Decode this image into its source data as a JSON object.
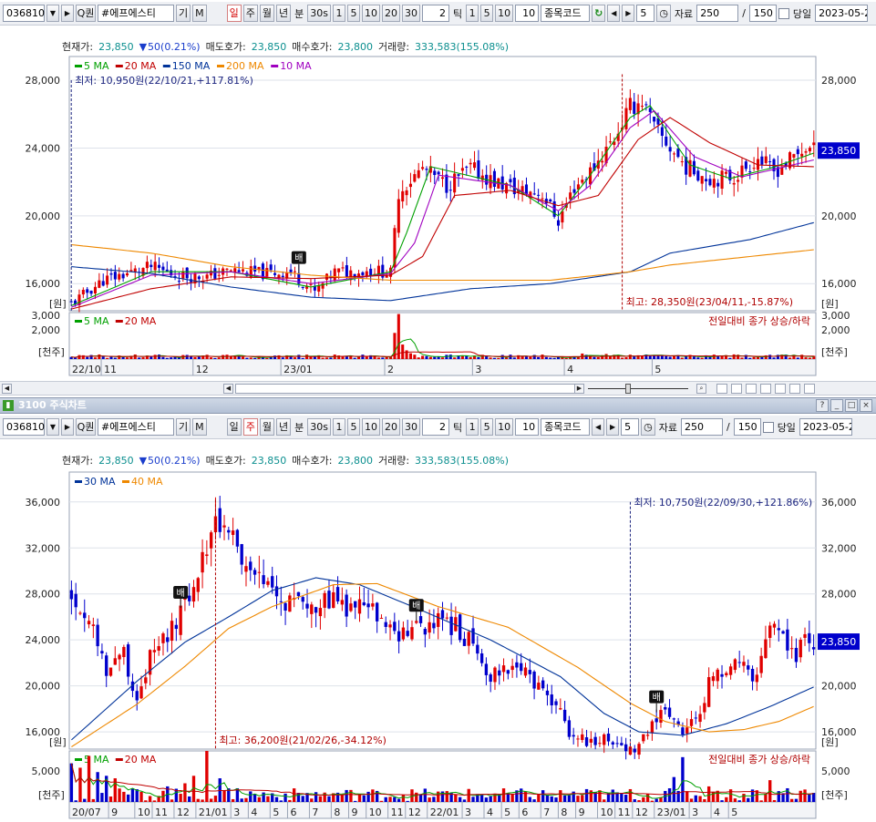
{
  "toolbar": {
    "code": "036810",
    "search_glyph": "Q",
    "search_label": "퀀",
    "name": "#에프에스티",
    "gi": "기",
    "m": "M",
    "periods": [
      "일",
      "주",
      "월",
      "년"
    ],
    "bun": "분",
    "sec30": "30s",
    "intervals": [
      "1",
      "5",
      "10",
      "20",
      "30"
    ],
    "tick_value": "2",
    "tick_label": "틱",
    "tick_intervals": [
      "1",
      "5",
      "10"
    ],
    "tick_num": "10",
    "code_field": "종목코드",
    "refresh_glyph": "↻",
    "step": "5",
    "data_label": "자료",
    "data_count": "250",
    "slash": "/",
    "data_total": "150",
    "today_label": "당일",
    "date": "2023-05-2"
  },
  "info": {
    "price_label": "현재가:",
    "price": "23,850",
    "change_arrow": "▼",
    "change": "50(0.21%)",
    "ask_label": "매도호가:",
    "ask": "23,850",
    "bid_label": "매수호가:",
    "bid": "23,800",
    "volume_label": "거래량:",
    "volume": "333,583(155.08%)"
  },
  "panel_title": "3100 주식차트",
  "panel_window_buttons": [
    "?",
    "_",
    "□",
    "×"
  ],
  "colors": {
    "up": "#e00000",
    "down": "#0000cc",
    "ma5": "#00a000",
    "ma20": "#c00000",
    "ma150": "#003399",
    "ma200": "#ee8800",
    "ma10": "#a000c0",
    "ma30": "#003399",
    "ma40": "#ee8800",
    "price_badge": "#0000ee",
    "grid": "#dde2ea",
    "text": "#222222",
    "annot": "#1a237e",
    "annot_red": "#b00000"
  },
  "chart_data": [
    {
      "type": "candlestick",
      "title": "",
      "period": "daily",
      "ylim": [
        14400,
        29400
      ],
      "yticks": [
        16000,
        20000,
        24000,
        28000
      ],
      "ytick_labels": [
        "16,000",
        "20,000",
        "24,000",
        "28,000"
      ],
      "y_unit": "[원]",
      "current_price": "23,850",
      "legend": [
        {
          "name": "5 MA",
          "color": "#00a000"
        },
        {
          "name": "20 MA",
          "color": "#c00000"
        },
        {
          "name": "150 MA",
          "color": "#003399"
        },
        {
          "name": "200 MA",
          "color": "#ee8800"
        },
        {
          "name": "10 MA",
          "color": "#a000c0"
        }
      ],
      "ohlc_anchors": [
        [
          0,
          14800
        ],
        [
          8,
          16200
        ],
        [
          14,
          16600
        ],
        [
          20,
          17000
        ],
        [
          26,
          16500
        ],
        [
          34,
          16400
        ],
        [
          40,
          16800
        ],
        [
          48,
          16600
        ],
        [
          55,
          16700
        ],
        [
          61,
          15500
        ],
        [
          66,
          16700
        ],
        [
          72,
          16700
        ],
        [
          76,
          16800
        ],
        [
          80,
          16600
        ],
        [
          82,
          21400
        ],
        [
          88,
          22800
        ],
        [
          94,
          21800
        ],
        [
          100,
          22800
        ],
        [
          106,
          22000
        ],
        [
          112,
          21500
        ],
        [
          118,
          21300
        ],
        [
          122,
          19700
        ],
        [
          126,
          21700
        ],
        [
          130,
          22600
        ],
        [
          136,
          24600
        ],
        [
          140,
          26400
        ],
        [
          143,
          26800
        ],
        [
          146,
          25200
        ],
        [
          150,
          24000
        ],
        [
          154,
          22900
        ],
        [
          160,
          22200
        ],
        [
          166,
          22300
        ],
        [
          172,
          23400
        ],
        [
          176,
          22600
        ],
        [
          180,
          23300
        ],
        [
          184,
          24000
        ],
        [
          186,
          23850
        ]
      ],
      "ma_anchors": {
        "5 MA": [
          [
            0,
            14700
          ],
          [
            20,
            16700
          ],
          [
            40,
            16700
          ],
          [
            60,
            15800
          ],
          [
            80,
            16700
          ],
          [
            84,
            19000
          ],
          [
            90,
            22900
          ],
          [
            110,
            21800
          ],
          [
            122,
            20000
          ],
          [
            130,
            22400
          ],
          [
            140,
            25800
          ],
          [
            145,
            26500
          ],
          [
            155,
            23000
          ],
          [
            165,
            22200
          ],
          [
            175,
            22800
          ],
          [
            186,
            23700
          ]
        ],
        "10 MA": [
          [
            0,
            14600
          ],
          [
            20,
            16500
          ],
          [
            40,
            16700
          ],
          [
            60,
            16000
          ],
          [
            80,
            16600
          ],
          [
            86,
            18400
          ],
          [
            92,
            22400
          ],
          [
            110,
            21800
          ],
          [
            122,
            20300
          ],
          [
            130,
            21800
          ],
          [
            140,
            25200
          ],
          [
            146,
            26200
          ],
          [
            156,
            23500
          ],
          [
            168,
            22300
          ],
          [
            186,
            23300
          ]
        ],
        "20 MA": [
          [
            0,
            14500
          ],
          [
            20,
            15700
          ],
          [
            40,
            16400
          ],
          [
            60,
            16300
          ],
          [
            80,
            16500
          ],
          [
            88,
            17600
          ],
          [
            96,
            21200
          ],
          [
            110,
            21500
          ],
          [
            122,
            20600
          ],
          [
            132,
            21200
          ],
          [
            142,
            24500
          ],
          [
            150,
            25800
          ],
          [
            160,
            24300
          ],
          [
            172,
            23000
          ],
          [
            186,
            22900
          ]
        ],
        "150 MA": [
          [
            0,
            17000
          ],
          [
            20,
            16600
          ],
          [
            40,
            15800
          ],
          [
            60,
            15200
          ],
          [
            80,
            15000
          ],
          [
            100,
            15700
          ],
          [
            120,
            16000
          ],
          [
            140,
            16700
          ],
          [
            150,
            17800
          ],
          [
            170,
            18600
          ],
          [
            186,
            19600
          ]
        ],
        "200 MA": [
          [
            0,
            18300
          ],
          [
            20,
            17800
          ],
          [
            40,
            17000
          ],
          [
            60,
            16500
          ],
          [
            80,
            16200
          ],
          [
            100,
            16200
          ],
          [
            120,
            16200
          ],
          [
            140,
            16700
          ],
          [
            150,
            17100
          ],
          [
            170,
            17600
          ],
          [
            186,
            18000
          ]
        ]
      },
      "xticks": [
        {
          "label": "22/10",
          "i": 0
        },
        {
          "label": "11",
          "i": 8
        },
        {
          "label": "12",
          "i": 31
        },
        {
          "label": "23/01",
          "i": 53
        },
        {
          "label": "2",
          "i": 79
        },
        {
          "label": "3",
          "i": 101
        },
        {
          "label": "4",
          "i": 124
        },
        {
          "label": "5",
          "i": 146
        }
      ],
      "annotations": [
        {
          "text": "최저: 10,950원(22/10/21,+117.81%)",
          "i": 0,
          "anchor_y": 28000
        },
        {
          "text": "최고: 28,350원(23/04/11,-15.87%)",
          "i": 138,
          "value": 28350
        }
      ],
      "marker": {
        "text": "배",
        "i": 57
      },
      "volume": {
        "ylim": [
          0,
          3200
        ],
        "yticks": [
          2000,
          3000
        ],
        "ytick_labels": [
          "2,000",
          "3,000"
        ],
        "y_unit": "[천주]",
        "legend": [
          {
            "name": "5 MA",
            "color": "#00a000"
          },
          {
            "name": "20 MA",
            "color": "#c00000"
          }
        ],
        "note": "전일대비 종가 상승/하락",
        "spikes": [
          [
            81,
            1800
          ],
          [
            82,
            3100
          ],
          [
            83,
            1000
          ],
          [
            84,
            600
          ],
          [
            85,
            400
          ],
          [
            110,
            300
          ],
          [
            128,
            380
          ],
          [
            134,
            350
          ],
          [
            140,
            300
          ],
          [
            166,
            320
          ]
        ]
      }
    },
    {
      "type": "candlestick",
      "title": "",
      "period": "weekly",
      "ylim": [
        14500,
        38600
      ],
      "yticks": [
        16000,
        20000,
        24000,
        28000,
        32000,
        36000
      ],
      "ytick_labels": [
        "16,000",
        "20,000",
        "24,000",
        "28,000",
        "32,000",
        "36,000"
      ],
      "y_unit": "[원]",
      "current_price": "23,850",
      "legend": [
        {
          "name": "30 MA",
          "color": "#003399"
        },
        {
          "name": "40 MA",
          "color": "#ee8800"
        }
      ],
      "ohlc_anchors": [
        [
          0,
          27800
        ],
        [
          4,
          25800
        ],
        [
          8,
          21500
        ],
        [
          12,
          22900
        ],
        [
          15,
          18800
        ],
        [
          18,
          22400
        ],
        [
          22,
          24200
        ],
        [
          26,
          26800
        ],
        [
          30,
          30900
        ],
        [
          33,
          34500
        ],
        [
          36,
          34000
        ],
        [
          40,
          29800
        ],
        [
          44,
          28800
        ],
        [
          48,
          27200
        ],
        [
          52,
          28000
        ],
        [
          56,
          26800
        ],
        [
          60,
          27500
        ],
        [
          64,
          26500
        ],
        [
          68,
          27000
        ],
        [
          72,
          24700
        ],
        [
          76,
          24500
        ],
        [
          80,
          25200
        ],
        [
          84,
          25500
        ],
        [
          88,
          25100
        ],
        [
          92,
          23500
        ],
        [
          96,
          20900
        ],
        [
          100,
          21800
        ],
        [
          104,
          20900
        ],
        [
          108,
          19200
        ],
        [
          112,
          18000
        ],
        [
          114,
          15800
        ],
        [
          118,
          15200
        ],
        [
          122,
          15500
        ],
        [
          126,
          14800
        ],
        [
          129,
          14500
        ],
        [
          132,
          16200
        ],
        [
          135,
          17500
        ],
        [
          138,
          17600
        ],
        [
          140,
          16100
        ],
        [
          144,
          17200
        ],
        [
          146,
          20600
        ],
        [
          150,
          21000
        ],
        [
          154,
          22500
        ],
        [
          156,
          20000
        ],
        [
          160,
          25800
        ],
        [
          163,
          23800
        ],
        [
          166,
          22700
        ],
        [
          168,
          24100
        ],
        [
          170,
          23850
        ]
      ],
      "ma_anchors": {
        "30 MA": [
          [
            0,
            15300
          ],
          [
            15,
            20400
          ],
          [
            26,
            23800
          ],
          [
            36,
            26000
          ],
          [
            46,
            28300
          ],
          [
            56,
            29400
          ],
          [
            66,
            28800
          ],
          [
            80,
            26600
          ],
          [
            96,
            24000
          ],
          [
            112,
            20800
          ],
          [
            122,
            17600
          ],
          [
            130,
            16000
          ],
          [
            140,
            15700
          ],
          [
            150,
            16700
          ],
          [
            160,
            18200
          ],
          [
            170,
            19900
          ]
        ],
        "40 MA": [
          [
            0,
            14700
          ],
          [
            15,
            18400
          ],
          [
            26,
            21700
          ],
          [
            36,
            25000
          ],
          [
            46,
            26900
          ],
          [
            60,
            28800
          ],
          [
            70,
            28900
          ],
          [
            84,
            26900
          ],
          [
            100,
            25100
          ],
          [
            116,
            21600
          ],
          [
            128,
            18500
          ],
          [
            136,
            16900
          ],
          [
            146,
            16000
          ],
          [
            154,
            16200
          ],
          [
            162,
            16900
          ],
          [
            170,
            18200
          ]
        ]
      },
      "xticks": [
        {
          "label": "20/07",
          "i": 0
        },
        {
          "label": "9",
          "i": 9
        },
        {
          "label": "10",
          "i": 15
        },
        {
          "label": "11",
          "i": 19
        },
        {
          "label": "12",
          "i": 24
        },
        {
          "label": "21/01",
          "i": 29
        },
        {
          "label": "3",
          "i": 37
        },
        {
          "label": "4",
          "i": 41
        },
        {
          "label": "5",
          "i": 46
        },
        {
          "label": "6",
          "i": 50
        },
        {
          "label": "7",
          "i": 55
        },
        {
          "label": "8",
          "i": 60
        },
        {
          "label": "9",
          "i": 64
        },
        {
          "label": "10",
          "i": 68
        },
        {
          "label": "11",
          "i": 73
        },
        {
          "label": "12",
          "i": 77
        },
        {
          "label": "22/01",
          "i": 82
        },
        {
          "label": "3",
          "i": 90
        },
        {
          "label": "4",
          "i": 95
        },
        {
          "label": "5",
          "i": 99
        },
        {
          "label": "6",
          "i": 103
        },
        {
          "label": "7",
          "i": 108
        },
        {
          "label": "8",
          "i": 112
        },
        {
          "label": "9",
          "i": 116
        },
        {
          "label": "10",
          "i": 121
        },
        {
          "label": "11",
          "i": 125
        },
        {
          "label": "12",
          "i": 129
        },
        {
          "label": "23/01",
          "i": 134
        },
        {
          "label": "3",
          "i": 142
        },
        {
          "label": "4",
          "i": 147
        },
        {
          "label": "5",
          "i": 151
        }
      ],
      "annotations": [
        {
          "text": "최고: 36,200원(21/02/26,-34.12%)",
          "i": 33,
          "value": 36200
        },
        {
          "text": "최저: 10,750원(22/09/30,+121.86%)",
          "i": 128,
          "anchor_y": 36000
        }
      ],
      "marker": [
        {
          "text": "배",
          "i": 25
        },
        {
          "text": "배",
          "i": 79
        },
        {
          "text": "배",
          "i": 134
        }
      ],
      "volume": {
        "ylim": [
          0,
          8200
        ],
        "yticks": [
          5000
        ],
        "ytick_labels": [
          "5,000"
        ],
        "y_unit": "[천주]",
        "legend": [
          {
            "name": "5 MA",
            "color": "#00a000"
          },
          {
            "name": "20 MA",
            "color": "#c00000"
          }
        ],
        "note": "전일대비 종가 상승/하락",
        "spikes": [
          [
            0,
            6200
          ],
          [
            2,
            5500
          ],
          [
            4,
            7400
          ],
          [
            6,
            4800
          ],
          [
            8,
            4200
          ],
          [
            10,
            3800
          ],
          [
            14,
            2200
          ],
          [
            22,
            2500
          ],
          [
            26,
            3000
          ],
          [
            28,
            4200
          ],
          [
            31,
            8200
          ],
          [
            34,
            3800
          ],
          [
            38,
            2200
          ],
          [
            60,
            1400
          ],
          [
            110,
            900
          ],
          [
            138,
            4000
          ],
          [
            140,
            7200
          ],
          [
            146,
            2500
          ],
          [
            148,
            1800
          ],
          [
            156,
            2000
          ],
          [
            160,
            3500
          ],
          [
            164,
            2200
          ],
          [
            168,
            2000
          ]
        ]
      }
    }
  ],
  "chart_bounds_note": ""
}
